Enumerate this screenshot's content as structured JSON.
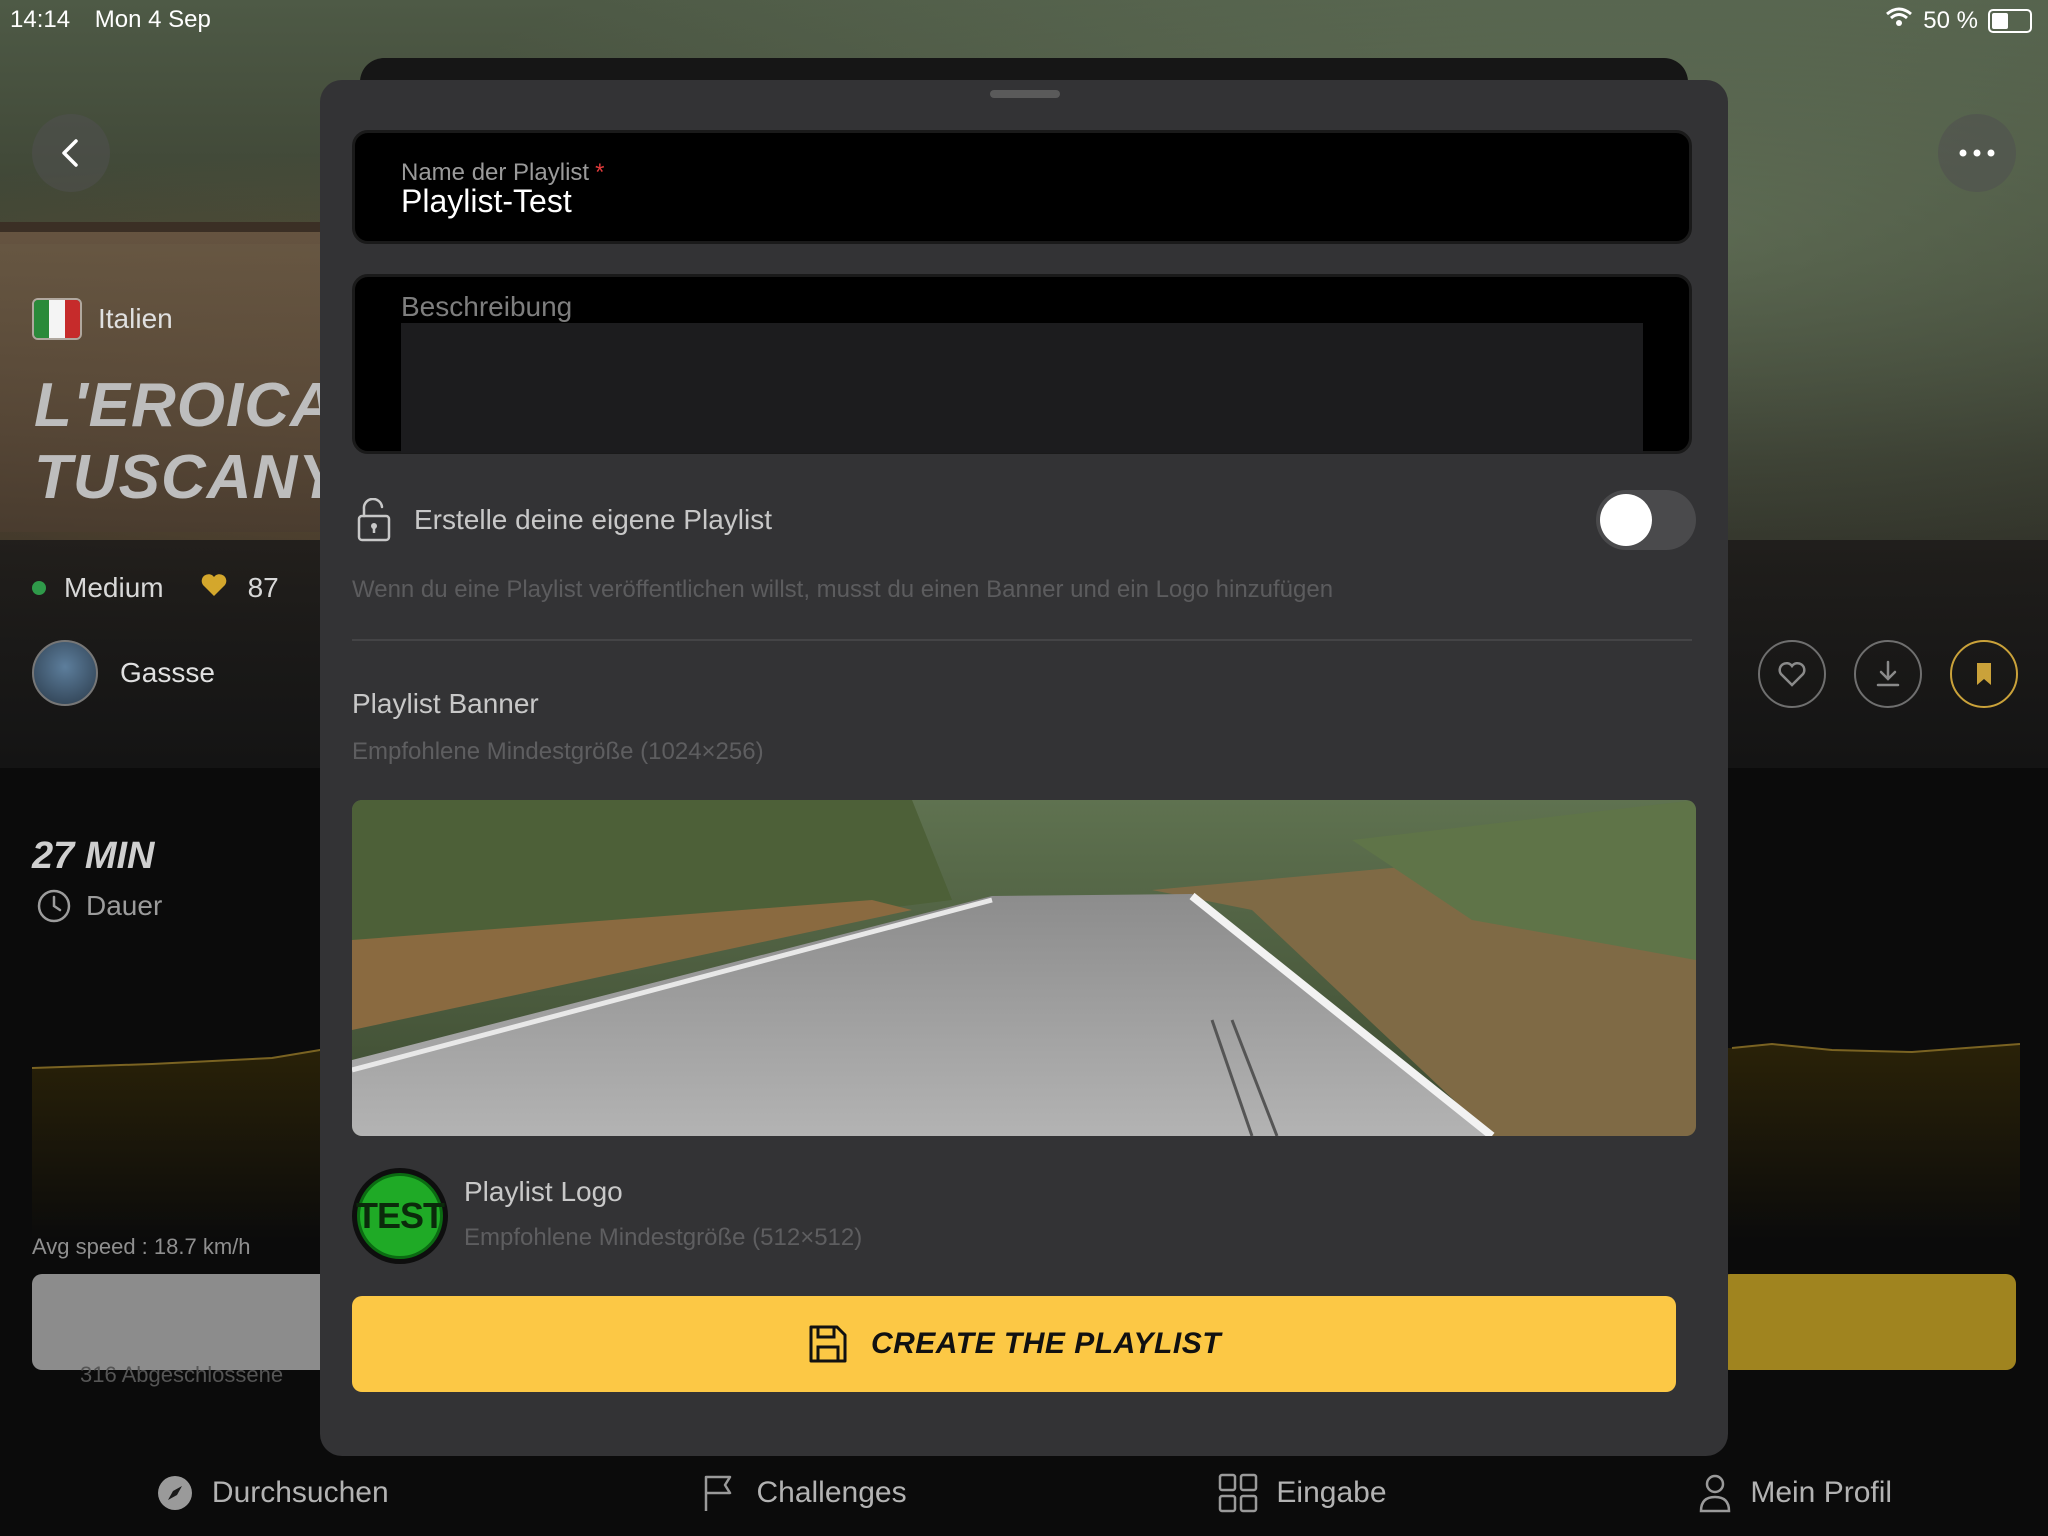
{
  "status_bar": {
    "time": "14:14",
    "date": "Mon 4 Sep",
    "battery": "50 %"
  },
  "route": {
    "country": "Italien",
    "title_line1": "L'EROICA",
    "title_line2": "TUSCANY",
    "difficulty": "Medium",
    "likes": "87",
    "author": "Gassse",
    "duration_value": "27 MIN",
    "duration_label": "Dauer",
    "avg_speed": "Avg speed : 18.7 km/h",
    "completed": "316 Abgeschlossene"
  },
  "modal": {
    "name_label": "Name der Playlist",
    "name_required_mark": "*",
    "name_value": "Playlist-Test",
    "description_label": "Beschreibung",
    "description_value": "",
    "privacy_label": "Erstelle deine eigene Playlist",
    "privacy_toggle_on": false,
    "publish_hint": "Wenn du eine Playlist veröffentlichen willst, musst du einen Banner und ein Logo hinzufügen",
    "banner_title": "Playlist Banner",
    "banner_hint": "Empfohlene Mindestgröße (1024×256)",
    "logo_title": "Playlist Logo",
    "logo_hint": "Empfohlene Mindestgröße (512×512)",
    "logo_text": "TEST",
    "create_button": "CREATE THE PLAYLIST"
  },
  "tabs": [
    {
      "label": "Durchsuchen",
      "icon": "compass-icon"
    },
    {
      "label": "Challenges",
      "icon": "flag-icon"
    },
    {
      "label": "Eingabe",
      "icon": "grid-icon"
    },
    {
      "label": "Mein Profil",
      "icon": "person-icon"
    }
  ],
  "colors": {
    "accent": "#fcc845",
    "modal_bg": "#333335",
    "logo_green": "#1faa26",
    "difficulty_dot": "#2f9a4a"
  }
}
